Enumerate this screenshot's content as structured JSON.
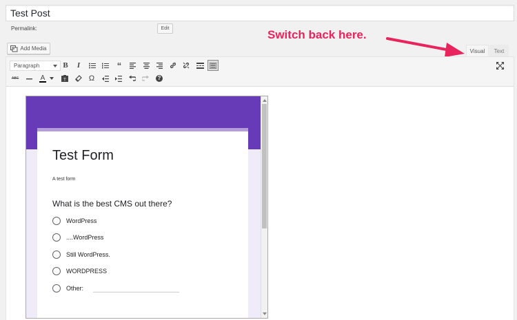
{
  "post": {
    "title": "Test Post",
    "permalink_label": "Permalink:",
    "edit_label": "Edit"
  },
  "media": {
    "add_media_label": "Add Media"
  },
  "annotation": {
    "text": "Switch back here.",
    "color": "#e8245c"
  },
  "tabs": {
    "visual": "Visual",
    "text": "Text"
  },
  "toolbar": {
    "format_select": "Paragraph",
    "row1_icons": [
      "bold-icon",
      "italic-icon",
      "bullet-list-icon",
      "numbered-list-icon",
      "blockquote-icon",
      "align-left-icon",
      "align-center-icon",
      "align-right-icon",
      "link-icon",
      "unlink-icon",
      "read-more-icon",
      "toolbar-toggle-icon"
    ],
    "row2_icons": [
      "strikethrough-icon",
      "horizontal-line-icon",
      "text-color-icon",
      "paste-text-icon",
      "clear-formatting-icon",
      "special-character-icon",
      "outdent-icon",
      "indent-icon",
      "undo-icon",
      "redo-icon",
      "help-icon"
    ],
    "bold": "B",
    "italic": "I",
    "special_char": "Ω",
    "strikethrough": "ABC",
    "text_color": "A",
    "help": "?"
  },
  "form": {
    "title": "Test Form",
    "description": "A test form",
    "question": "What is the best CMS out there?",
    "options": [
      "WordPress",
      "....WordPress",
      "Still WordPress.",
      "WORDPRESS"
    ],
    "other_label": "Other:",
    "header_color": "#673ab7",
    "accent_color": "#b39ddb"
  }
}
